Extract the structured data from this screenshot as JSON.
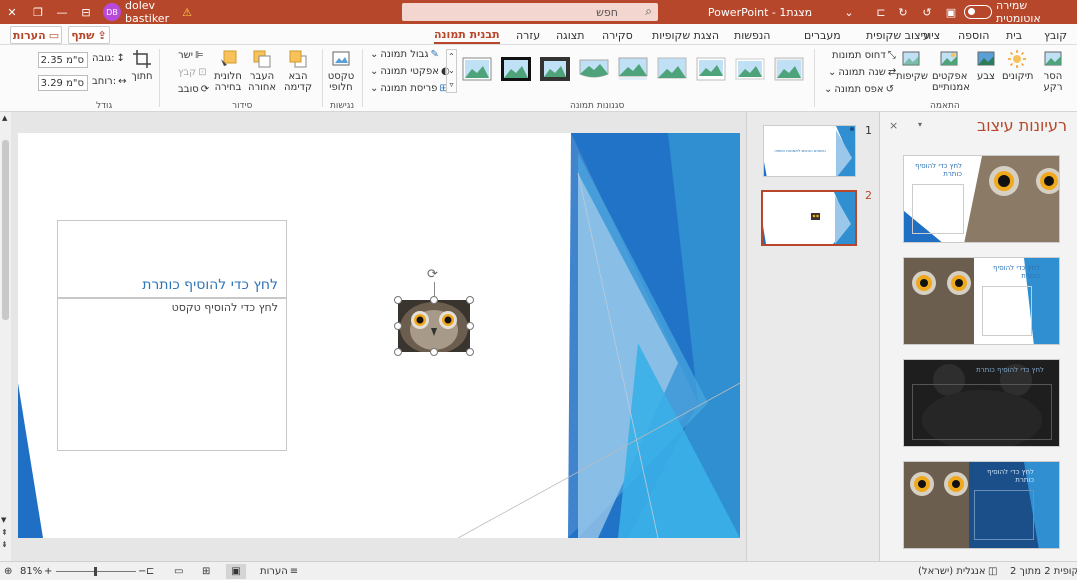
{
  "titlebar": {
    "autosave_label": "שמירה אוטומטית",
    "doc_title": "PowerPoint - מצגת1",
    "search_placeholder": "חפש",
    "user_name": "dolev bastiker",
    "user_initials": "DB"
  },
  "tabs": [
    {
      "label": "קובץ"
    },
    {
      "label": "בית"
    },
    {
      "label": "הוספה"
    },
    {
      "label": "ציור"
    },
    {
      "label": "עיצוב שקופית"
    },
    {
      "label": "מעברים"
    },
    {
      "label": "הנפשות"
    },
    {
      "label": "הצגת שקופיות"
    },
    {
      "label": "סקירה"
    },
    {
      "label": "תצוגה"
    },
    {
      "label": "עזרה"
    },
    {
      "label": "תבנית תמונה"
    }
  ],
  "share_label": "שתף",
  "comments_label": "הערות",
  "ribbon": {
    "adjust": {
      "remove_bg": [
        "הסר",
        "רקע"
      ],
      "corrections": "תיקונים",
      "color": "צבע",
      "artistic": [
        "אפקטים",
        "אמנותיים"
      ],
      "transparency": "שקיפות",
      "compress": "דחוס תמונות",
      "change": "שנה תמונה",
      "reset": "אפס תמונה",
      "group_label": "התאמה"
    },
    "styles": {
      "group_label": "סגנונות תמונה",
      "border": "גבול תמונה",
      "effects": "אפקטי תמונה",
      "layout": "פריסת תמונה"
    },
    "accessibility": {
      "alt_text": [
        "טקסט",
        "חלופי"
      ],
      "group_label": "נגישות"
    },
    "arrange": {
      "bring_forward": [
        "הבא",
        "קדימה"
      ],
      "send_backward": [
        "העבר",
        "אחורה"
      ],
      "selection_pane": [
        "חלונית",
        "בחירה"
      ],
      "align": "ישר",
      "group": "קבץ",
      "rotate": "סובב",
      "group_label": "סידור"
    },
    "size": {
      "crop": "חתוך",
      "height_label": "גובה:",
      "height_value": "2.35 ס\"מ",
      "width_label": "רוחב:",
      "width_value": "3.29 ס\"מ",
      "group_label": "גודל"
    }
  },
  "slide": {
    "title_placeholder": "לחץ כדי להוסיף כותרת",
    "text_placeholder": "לחץ כדי להוסיף טקסט"
  },
  "thumbnails": [
    {
      "number": "1",
      "caption": "נושאים הבאים לתמונות אשפה"
    },
    {
      "number": "2"
    }
  ],
  "design_pane": {
    "title": "רעיונות עיצוב",
    "idea_title": "לחץ כדי להוסיף כותרת",
    "idea_title_short": "לחץ כדי להוסיף\nכותרת"
  },
  "statusbar": {
    "slide_info": "שקופית 2 מתוך 2",
    "language": "אנגלית (ישראל)",
    "notes": "הערות",
    "zoom": "81%"
  },
  "colors": {
    "accent": "#b7472a",
    "title_blue": "#2e75b6",
    "slide_blue": "#1f6fc5"
  }
}
